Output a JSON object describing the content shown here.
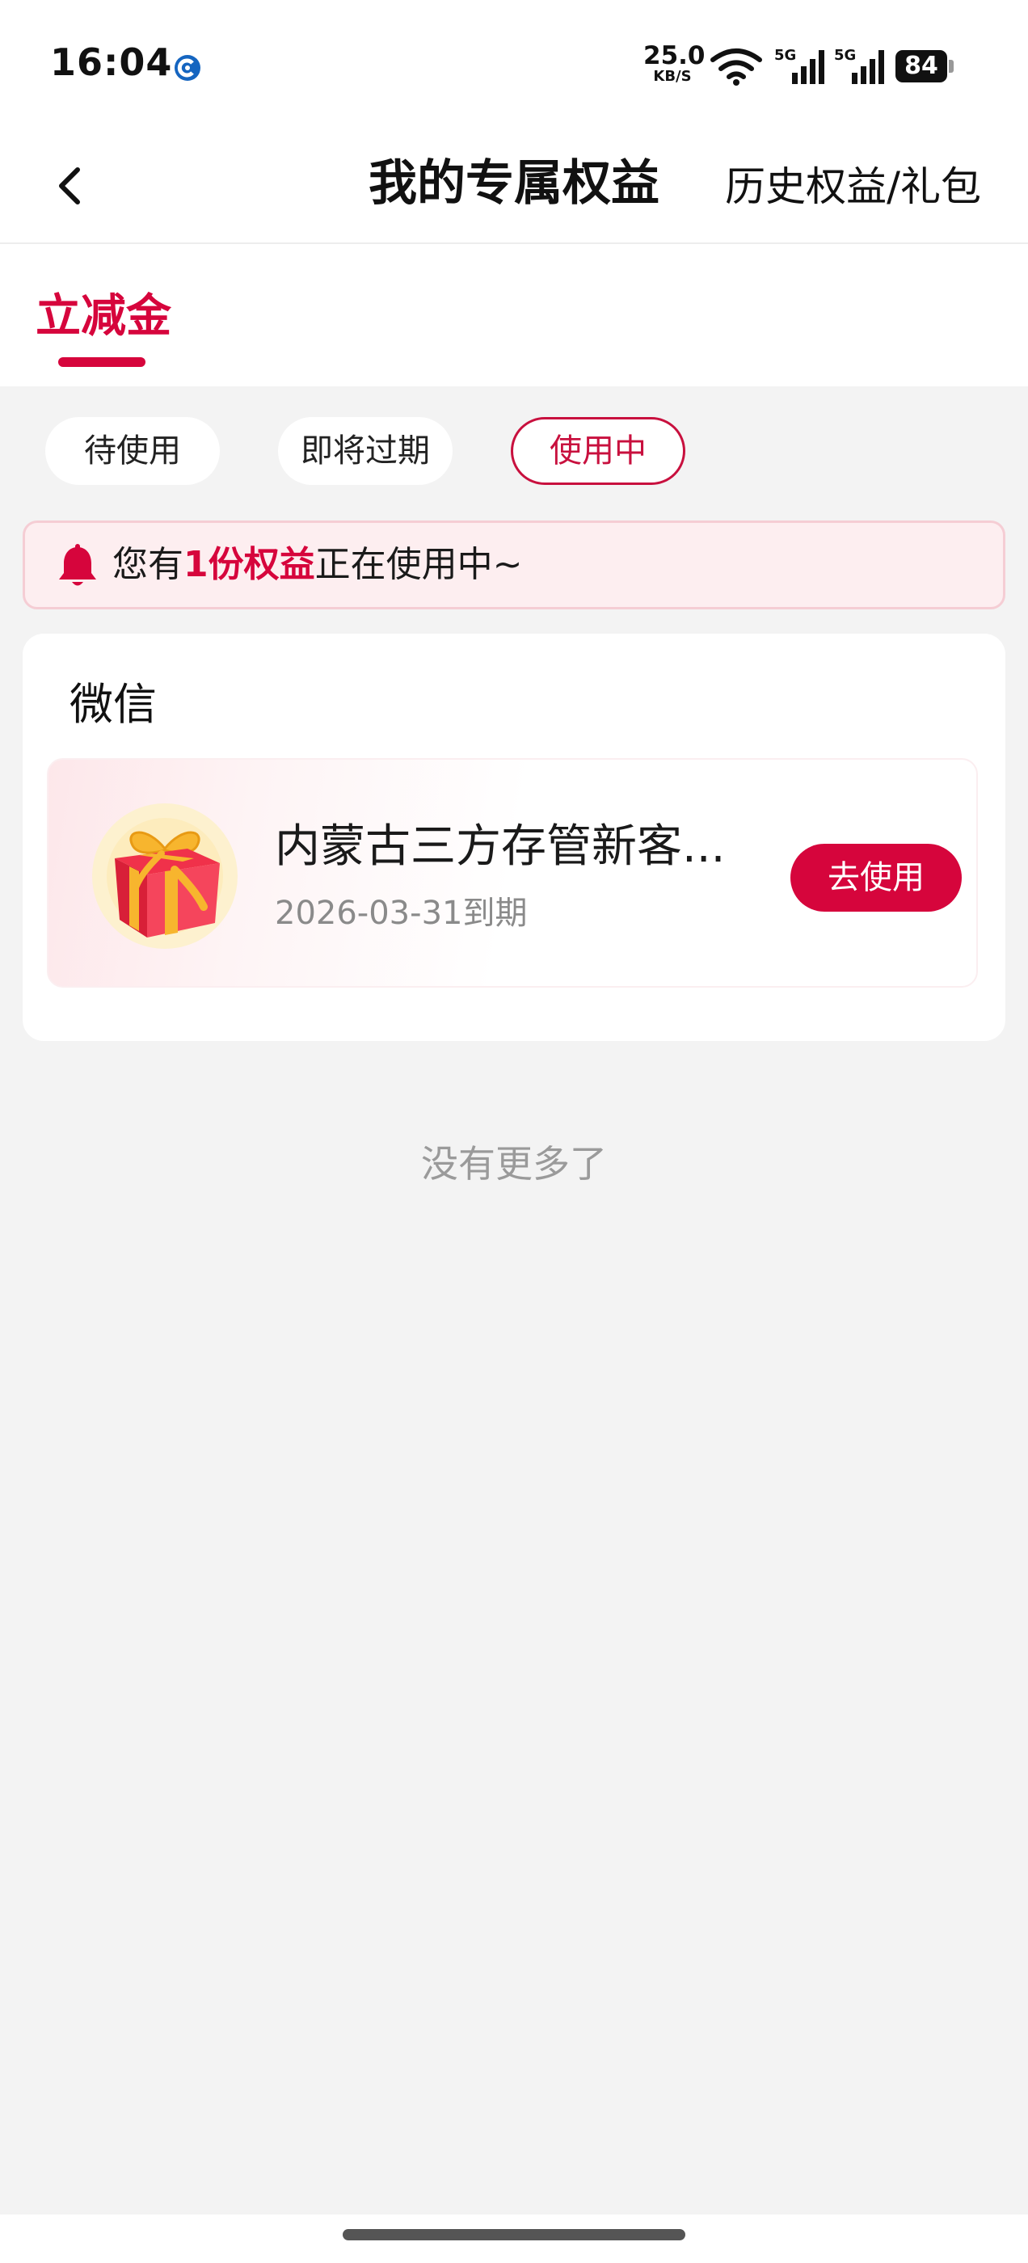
{
  "status_bar": {
    "time": "16:04",
    "net_speed": "25.0",
    "net_speed_unit": "KB/S",
    "network_1": "5G",
    "network_2": "5G",
    "battery": "84",
    "icons": [
      "app-notification-icon",
      "wifi-icon",
      "signal-5g-icon",
      "signal-5g-icon",
      "battery-icon"
    ]
  },
  "header": {
    "title": "我的专属权益",
    "history_link": "历史权益/礼包",
    "back_icon": "chevron-left-icon"
  },
  "tabs": [
    {
      "label": "立减金",
      "active": true
    }
  ],
  "filters": [
    {
      "label": "待使用",
      "selected": false
    },
    {
      "label": "即将过期",
      "selected": false
    },
    {
      "label": "使用中",
      "selected": true
    }
  ],
  "notice": {
    "icon": "bell-icon",
    "prefix": "您有",
    "highlight": "1份权益",
    "suffix": "正在使用中~"
  },
  "groups": [
    {
      "title": "微信",
      "items": [
        {
          "icon": "gift-box-icon",
          "name": "内蒙古三方存管新客...",
          "expiry": "2026-03-31到期",
          "action": "去使用"
        }
      ]
    }
  ],
  "footer_text": "没有更多了",
  "colors": {
    "accent": "#d6053c",
    "background": "#f3f3f3",
    "notice_bg": "#fdeef0",
    "notice_border": "#f5cdd4",
    "secondary_text": "#8a8a8a"
  }
}
